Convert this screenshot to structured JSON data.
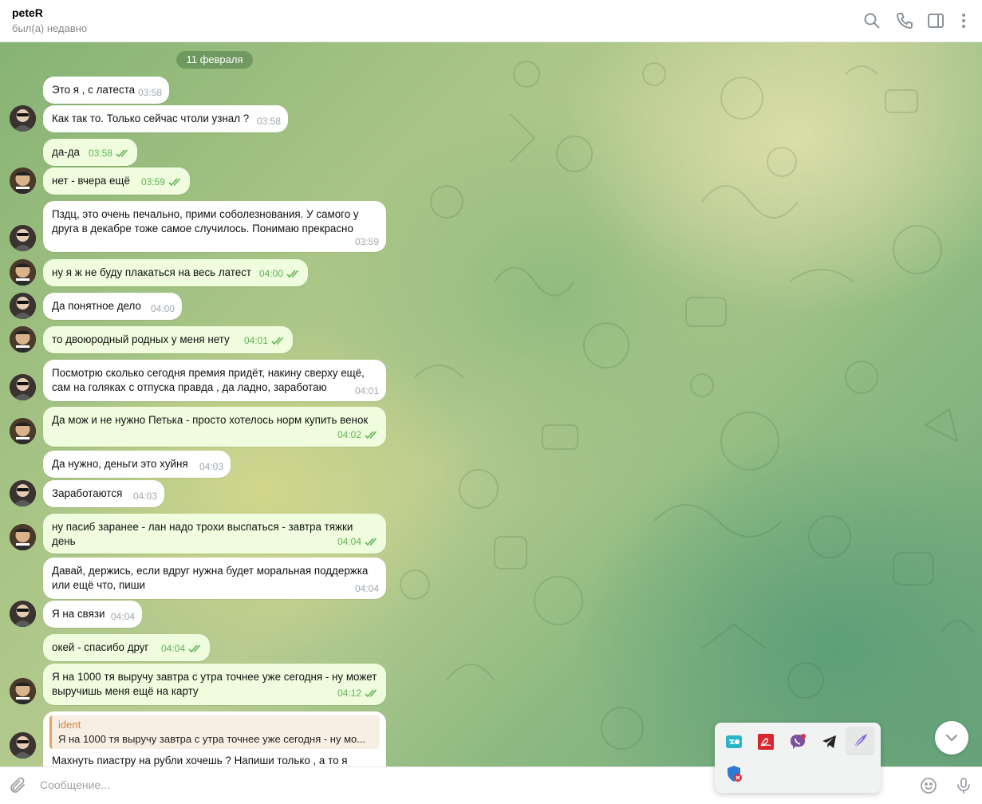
{
  "header": {
    "title": "peteR",
    "status": "был(а) недавно",
    "icons": [
      "search-icon",
      "phone-icon",
      "sidebar-toggle-icon",
      "more-vertical-icon"
    ]
  },
  "chat": {
    "date_label": "11 февраля",
    "messages": [
      {
        "direction": "in",
        "text": "Это я , с латеста",
        "time": "03:58",
        "read": false
      },
      {
        "direction": "in",
        "text": "Как так то. Только сейчас чтоли узнал ?",
        "time": "03:58",
        "read": false
      },
      {
        "direction": "out",
        "text": "да-да",
        "time": "03:58",
        "read": true
      },
      {
        "direction": "out",
        "text": "нет - вчера ещё",
        "time": "03:59",
        "read": true
      },
      {
        "direction": "in",
        "text_lines": [
          "Пздц, это очень печально, прими соболезнования. У самого у",
          "друга в декабре тоже самое случилось. Понимаю прекрасно"
        ],
        "time": "03:59",
        "read": false
      },
      {
        "direction": "out",
        "text": "ну я ж не буду плакаться на весь латест",
        "time": "04:00",
        "read": true
      },
      {
        "direction": "in",
        "text": "Да понятное дело",
        "time": "04:00",
        "read": false
      },
      {
        "direction": "out",
        "text": "то двоюродный родных у меня нету",
        "time": "04:01",
        "read": true
      },
      {
        "direction": "in",
        "text_lines": [
          "Посмотрю сколько сегодня премия придёт, накину сверху ещё,",
          "сам на голяках с отпуска правда , да ладно, заработаю"
        ],
        "time": "04:01",
        "read": false
      },
      {
        "direction": "out",
        "text_lines": [
          "Да мож и не нужно Петька - просто хотелось норм купить венок"
        ],
        "time": "04:02",
        "read": true
      },
      {
        "direction": "in",
        "text": "Да нужно, деньги это хуйня",
        "time": "04:03",
        "read": false
      },
      {
        "direction": "in",
        "text": "Заработаются",
        "time": "04:03",
        "read": false
      },
      {
        "direction": "out",
        "text_lines": [
          "ну пасиб заранее - лан надо трохи выспаться - завтра тяжки день"
        ],
        "time": "04:04",
        "read": true
      },
      {
        "direction": "in",
        "text_lines": [
          "Давай, держись, если вдруг нужна будет моральная поддержка",
          "или ещё что, пиши"
        ],
        "time": "04:04",
        "read": false
      },
      {
        "direction": "in",
        "text": "Я на связи",
        "time": "04:04",
        "read": false
      },
      {
        "direction": "out",
        "text": "окей - спасибо друг",
        "time": "04:04",
        "read": true
      },
      {
        "direction": "out",
        "text_lines": [
          "Я на 1000 тя выручу завтра с утра точнее уже сегодня - ну может",
          "выручишь меня ещё на карту"
        ],
        "time": "04:12",
        "read": true
      },
      {
        "direction": "in",
        "reply_name": "ident",
        "reply_text": "Я на 1000 тя выручу завтра с утра точнее уже сегодня - ну мо...",
        "text": "Махнуть пиастру на рубли хочешь ? Напиши только , а то я"
      }
    ]
  },
  "composer": {
    "placeholder": "Сообщение...",
    "icons": [
      "attach-icon",
      "emoji-icon",
      "microphone-icon"
    ]
  },
  "tray": {
    "apps": [
      "yandex-disk-icon",
      "adobe-reader-icon",
      "viber-icon",
      "telegram-icon",
      "feather-app-icon",
      "security-shield-icon"
    ]
  },
  "colors": {
    "incoming_bubble": "#ffffff",
    "outgoing_bubble": "#effdde",
    "outgoing_meta": "#5fb251",
    "reply_accent": "#d4843d"
  }
}
